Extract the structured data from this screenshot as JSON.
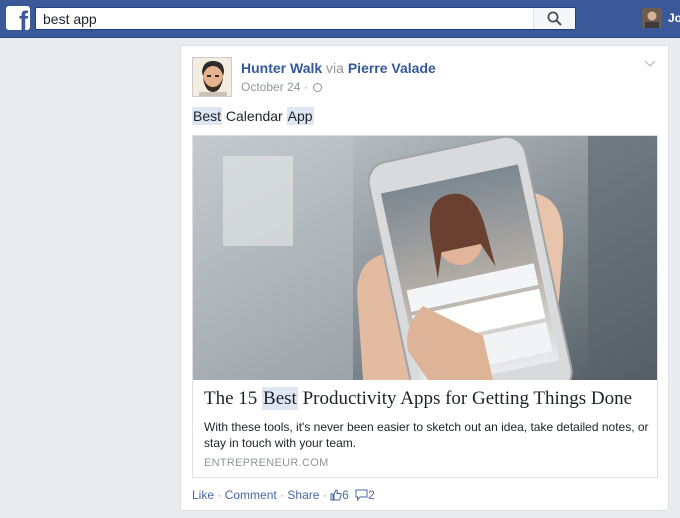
{
  "topbar": {
    "search_value": "best app",
    "user_name_partial": "Jo"
  },
  "post": {
    "author": "Hunter Walk",
    "via_word": "via",
    "via_name": "Pierre Valade",
    "date": "October 24",
    "date_separator": "·",
    "text_parts": [
      "Best",
      " Calendar ",
      "App"
    ],
    "link": {
      "title_before": "The 15 ",
      "title_highlight": "Best",
      "title_after": " Productivity Apps for Getting Things Done",
      "description": "With these tools, it's never been easier to sketch out an idea, take detailed notes, or stay in touch with your team.",
      "domain": "ENTREPRENEUR.COM"
    },
    "actions": {
      "like": "Like",
      "comment": "Comment",
      "share": "Share",
      "separator": "·",
      "like_count": "6",
      "comment_count": "2"
    }
  },
  "colors": {
    "topbar": "#3b5998",
    "link_blue": "#365899",
    "highlight": "#dfe6f3"
  }
}
